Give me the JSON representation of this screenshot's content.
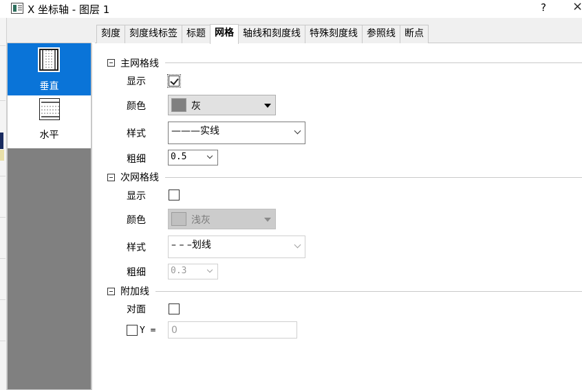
{
  "window": {
    "title": "X 坐标轴 - 图层 1",
    "help": "?",
    "close": "×"
  },
  "tabs": [
    {
      "label": "刻度",
      "active": false
    },
    {
      "label": "刻度线标签",
      "active": false
    },
    {
      "label": "标题",
      "active": false
    },
    {
      "label": "网格",
      "active": true
    },
    {
      "label": "轴线和刻度线",
      "active": false
    },
    {
      "label": "特殊刻度线",
      "active": false
    },
    {
      "label": "参照线",
      "active": false
    },
    {
      "label": "断点",
      "active": false
    }
  ],
  "side_panel": {
    "vertical": {
      "label": "垂直",
      "selected": true,
      "icon": "vertical-grid-icon"
    },
    "horizontal": {
      "label": "水平",
      "selected": false,
      "icon": "horizontal-grid-icon"
    }
  },
  "major": {
    "title": "主网格线",
    "show_label": "显示",
    "show_checked": true,
    "color_label": "颜色",
    "color_value": "灰",
    "color_hex": "#808080",
    "style_label": "样式",
    "style_value": "———实线",
    "thickness_label": "粗细",
    "thickness_value": "0.5"
  },
  "minor": {
    "title": "次网格线",
    "show_label": "显示",
    "show_checked": false,
    "color_label": "颜色",
    "color_value": "浅灰",
    "color_hex": "#c0c0c0",
    "style_label": "样式",
    "style_value": "– – –划线",
    "thickness_label": "粗细",
    "thickness_value": "0.3"
  },
  "additional": {
    "title": "附加线",
    "opposite_label": "对面",
    "opposite_checked": false,
    "y_label": "Y =",
    "y_checked": false,
    "y_value": "0"
  }
}
